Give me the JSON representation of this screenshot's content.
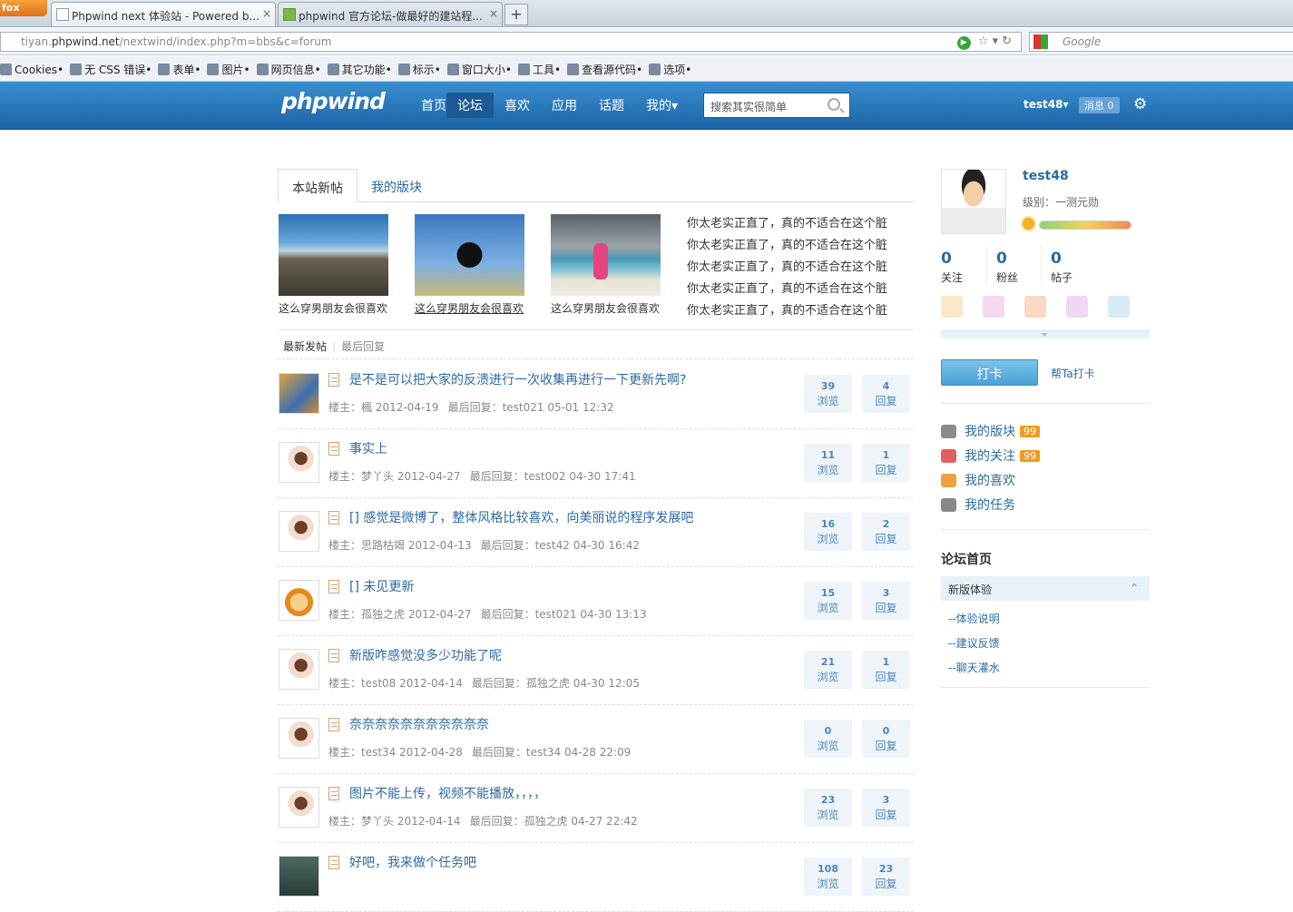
{
  "browser": {
    "ff_button": "fox",
    "tabs": [
      {
        "title": "Phpwind next 体验站 - Powered b...",
        "close": "×"
      },
      {
        "title": "phpwind 官方论坛-做最好的建站程...",
        "close": "×"
      }
    ],
    "newtab": "+",
    "url_prefix": "tiyan.",
    "url_domain": "phpwind.net",
    "url_path": "/nextwind/index.php?m=bbs&c=forum",
    "search_engine": "Google",
    "bookmarks": [
      "Cookies•",
      "无 CSS 错误•",
      "表单•",
      "图片•",
      "网页信息•",
      "其它功能•",
      "标示•",
      "窗口大小•",
      "工具•",
      "查看源代码•",
      "选项•"
    ]
  },
  "header": {
    "logo": "phpwind",
    "nav": [
      "首页",
      "论坛",
      "喜欢",
      "应用",
      "话题",
      "我的▾"
    ],
    "active_nav": 1,
    "search_placeholder": "搜索其实很简单",
    "user": "test48▾",
    "messages": "消息 0"
  },
  "main": {
    "tabs": [
      "本站新帖",
      "我的版块"
    ],
    "pictures": [
      {
        "caption": "这么穿男朋友会很喜欢"
      },
      {
        "caption": "这么穿男朋友会很喜欢"
      },
      {
        "caption": "这么穿男朋友会很喜欢"
      }
    ],
    "headlines": [
      "你太老实正直了，真的不适合在这个脏",
      "你太老实正直了，真的不适合在这个脏",
      "你太老实正直了，真的不适合在这个脏",
      "你太老实正直了，真的不适合在这个脏",
      "你太老实正直了，真的不适合在这个脏"
    ],
    "subtabs": [
      "最新发帖",
      "最后回复"
    ],
    "views_label": "浏览",
    "replies_label": "回复",
    "threads": [
      {
        "title": "是不是可以把大家的反溃进行一次收集再进行一下更新先啊?",
        "author": "楼主：楓 2012-04-19",
        "last": "最后回复：test021 05-01 12:32",
        "views": "39",
        "replies": "4"
      },
      {
        "title": "事实上",
        "author": "楼主：梦丫头 2012-04-27",
        "last": "最后回复：test002 04-30 17:41",
        "views": "11",
        "replies": "1"
      },
      {
        "title": "[] 感觉是微博了，整体风格比较喜欢，向美丽说的程序发展吧",
        "author": "楼主：思路枯竭 2012-04-13",
        "last": "最后回复：test42 04-30 16:42",
        "views": "16",
        "replies": "2"
      },
      {
        "title": "[] 未见更新",
        "author": "楼主：孤独之虎 2012-04-27",
        "last": "最后回复：test021 04-30 13:13",
        "views": "15",
        "replies": "3"
      },
      {
        "title": "新版咋感觉没多少功能了呢",
        "author": "楼主：test08 2012-04-14",
        "last": "最后回复：孤独之虎 04-30 12:05",
        "views": "21",
        "replies": "1"
      },
      {
        "title": "奈奈奈奈奈奈奈奈奈奈奈",
        "author": "楼主：test34 2012-04-28",
        "last": "最后回复：test34 04-28 22:09",
        "views": "0",
        "replies": "0"
      },
      {
        "title": "图片不能上传，视频不能播放，，，，",
        "author": "楼主：梦丫头 2012-04-14",
        "last": "最后回复：孤独之虎 04-27 22:42",
        "views": "23",
        "replies": "3"
      },
      {
        "title": "好吧，我来做个任务吧",
        "author": "",
        "last": "",
        "views": "108",
        "replies": "23"
      }
    ]
  },
  "sidebar": {
    "username": "test48",
    "level": "级别：一测元勋",
    "stats": [
      {
        "n": "0",
        "label": "关注"
      },
      {
        "n": "0",
        "label": "粉丝"
      },
      {
        "n": "0",
        "label": "帖子"
      }
    ],
    "checkin": "打卡",
    "help_checkin": "帮Ta打卡",
    "links": [
      {
        "label": "我的版块",
        "count": "99"
      },
      {
        "label": "我的关注",
        "count": "99"
      },
      {
        "label": "我的喜欢",
        "count": ""
      },
      {
        "label": "我的任务",
        "count": ""
      }
    ],
    "forum_title": "论坛首页",
    "forum_group": "新版体验",
    "forum_subs": [
      "--体验说明",
      "--建议反馈",
      "--聊天灌水"
    ]
  }
}
